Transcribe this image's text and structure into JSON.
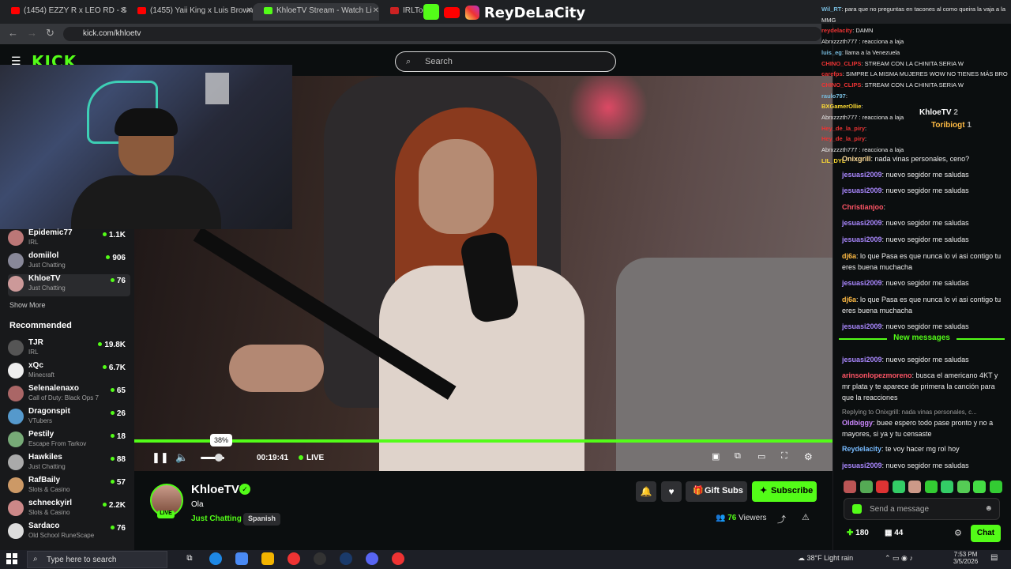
{
  "browser": {
    "tabs": [
      {
        "label": "(1454) EZZY R x LEO RD - SE D",
        "active": false
      },
      {
        "label": "(1455) Yaii King x Luis Brown - T",
        "active": false
      },
      {
        "label": "KhloeTV Stream - Watch Li",
        "active": true
      },
      {
        "label": "IRLTool",
        "active": false
      }
    ],
    "url": "kick.com/khloetv"
  },
  "overlay_brand": "ReyDeLaCity",
  "site": {
    "logo": "KICK",
    "search_placeholder": "Search"
  },
  "sidebar": {
    "following": [
      {
        "name": "Epidemic77",
        "category": "IRL",
        "viewers": "1.1K",
        "color": "#b77"
      },
      {
        "name": "domiilol",
        "category": "Just Chatting",
        "viewers": "906",
        "color": "#889"
      },
      {
        "name": "KhloeTV",
        "category": "Just Chatting",
        "viewers": "76",
        "color": "#c99",
        "selected": true
      }
    ],
    "show_more": "Show More",
    "recommended_title": "Recommended",
    "recommended": [
      {
        "name": "TJR",
        "category": "IRL",
        "viewers": "19.8K",
        "color": "#555"
      },
      {
        "name": "xQc",
        "category": "Minecraft",
        "viewers": "6.7K",
        "color": "#eee"
      },
      {
        "name": "Selenalenaxo",
        "category": "Call of Duty: Black Ops 7",
        "viewers": "65",
        "color": "#a66"
      },
      {
        "name": "Dragonspit",
        "category": "VTubers",
        "viewers": "26",
        "color": "#59c"
      },
      {
        "name": "Pestily",
        "category": "Escape From Tarkov",
        "viewers": "18",
        "color": "#7a7"
      },
      {
        "name": "Hawkiles",
        "category": "Just Chatting",
        "viewers": "88",
        "color": "#aaa"
      },
      {
        "name": "RafBaily",
        "category": "Slots & Casino",
        "viewers": "57",
        "color": "#c96"
      },
      {
        "name": "schneckyirl",
        "category": "Slots & Casino",
        "viewers": "2.2K",
        "color": "#c88"
      },
      {
        "name": "Sardaco",
        "category": "Old School RuneScape",
        "viewers": "76",
        "color": "#ddd"
      }
    ]
  },
  "player": {
    "volume_tooltip": "38%",
    "volume_level": 0.38,
    "time": "00:19:41",
    "live_label": "LIVE"
  },
  "channel": {
    "name": "KhloeTV",
    "title": "Ola",
    "category": "Just Chatting",
    "language": "Spanish",
    "live_badge": "LIVE",
    "gift_label": "Gift Subs",
    "subscribe_label": "Subscribe",
    "viewers": "76",
    "viewers_label": "Viewers"
  },
  "overlay_chat": [
    {
      "user": "Wil_RT",
      "text": ": para que no preguntas en tacones al como queira la vaja a la",
      "color": "#7bd"
    },
    {
      "user": "",
      "text": "MMG",
      "color": "#fff"
    },
    {
      "user": "reydelacity",
      "text": ": DAMN",
      "color": "#e33"
    },
    {
      "user": "",
      "text": "Abrxzzzth777 : reacciona a laja",
      "color": "#fff"
    },
    {
      "user": "luis_eg",
      "text": ": llama a la Venezuela",
      "color": "#7bd"
    },
    {
      "user": "CHINO_CLIPS",
      "text": ": STREAM CON LA CHINITA SERIA W",
      "color": "#e33"
    },
    {
      "user": "carefps",
      "text": ": SIMPRE LA MISMA MUJERES WOW NO TIENES MÁS BRO",
      "color": "#e33"
    },
    {
      "user": "CHINO_CLIPS",
      "text": ": STREAM CON LA CHINITA SERIA W",
      "color": "#e33"
    },
    {
      "user": "raulo797",
      "text": ":",
      "color": "#7bd"
    },
    {
      "user": "BXGamerOllie",
      "text": ":",
      "color": "#fd3"
    },
    {
      "user": "",
      "text": "Abrxzzzth777 : reacciona a laja",
      "color": "#fff"
    },
    {
      "user": "Hey_de_la_piry",
      "text": ":",
      "color": "#e33"
    },
    {
      "user": "Hey_de_la_piry",
      "text": ":",
      "color": "#e33"
    },
    {
      "user": "",
      "text": "Abrxzzzth777 : reacciona a laja",
      "color": "#fff"
    },
    {
      "user": "LIL_DYL",
      "text": "",
      "color": "#fd3"
    }
  ],
  "chat": {
    "header": "Chat",
    "top_chatters": [
      {
        "name": "KhloeTV",
        "count": "2"
      },
      {
        "name": "Toribiogt",
        "count": "1"
      }
    ],
    "messages": [
      {
        "user": "Onixgrill",
        "text": ": nada vinas personales, ceno?",
        "color": "#fd9"
      },
      {
        "user": "jesuasi2009",
        "text": ": nuevo segidor me saludas",
        "color": "#a8f"
      },
      {
        "user": "jesuasi2009",
        "text": ": nuevo segidor me saludas",
        "color": "#a8f"
      },
      {
        "user": "Christianjoo",
        "text": ":",
        "color": "#f56"
      },
      {
        "user": "jesuasi2009",
        "text": ": nuevo segidor me saludas",
        "color": "#a8f"
      },
      {
        "user": "jesuasi2009",
        "text": ": nuevo segidor me saludas",
        "color": "#a8f"
      },
      {
        "user": "dj6a",
        "text": ": lo que Pasa es que nunca lo vi asi contigo tu eres buena muchacha",
        "color": "#fb4"
      },
      {
        "user": "jesuasi2009",
        "text": ": nuevo segidor me saludas",
        "color": "#a8f"
      },
      {
        "user": "dj6a",
        "text": ": lo que Pasa es que nunca lo vi asi contigo tu eres buena muchacha",
        "color": "#fb4"
      },
      {
        "user": "jesuasi2009",
        "text": ": nuevo segidor me saludas",
        "color": "#a8f"
      }
    ],
    "new_messages": "New messages",
    "after": [
      {
        "user": "jesuasi2009",
        "text": ": nuevo segidor me saludas",
        "color": "#a8f"
      },
      {
        "user": "arinsonlopezmoreno",
        "text": ": busca el americano 4KT y mr plata y te aparece de primera la canción para que la reacciones",
        "color": "#f56"
      }
    ],
    "reply_to": "Replying to Onixgrill: nada vinas personales, c...",
    "after2": [
      {
        "user": "Oldbiggy",
        "text": ": buee espero todo pase pronto y no a mayores, si ya y tu censaste",
        "color": "#c8f"
      },
      {
        "user": "Reydelacity",
        "text": ": te voy hacer mg rol hoy",
        "color": "#7bf"
      },
      {
        "user": "jesuasi2009",
        "text": ": nuevo segidor me saludas",
        "color": "#a8f"
      }
    ],
    "send_placeholder": "Send a message",
    "points": "180",
    "gifts": "44",
    "chat_button": "Chat"
  },
  "taskbar": {
    "search_placeholder": "Type here to search",
    "weather_temp": "38°F",
    "weather_desc": "Light rain",
    "time": "7:53 PM",
    "date": "3/5/2026"
  }
}
